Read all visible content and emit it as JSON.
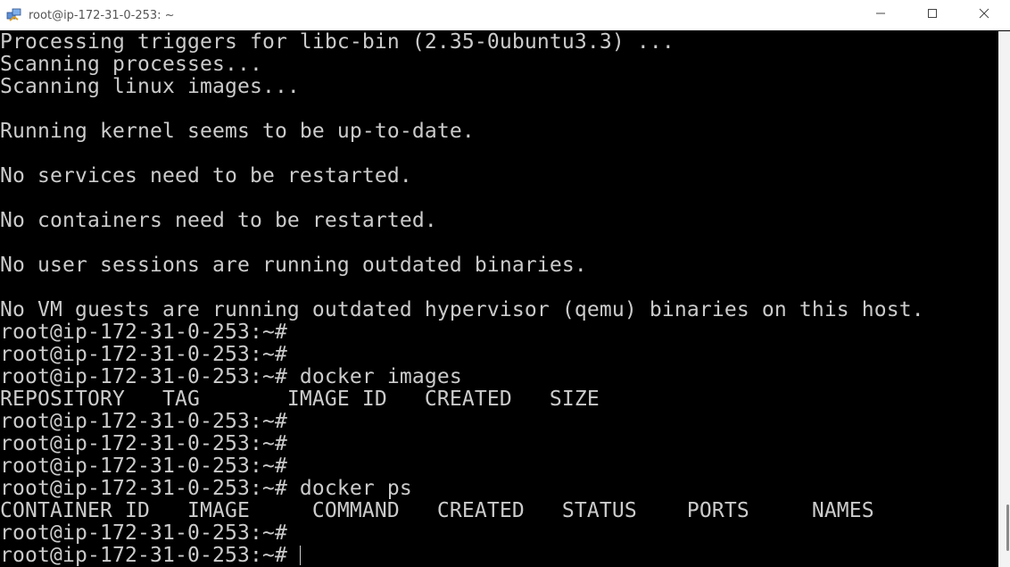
{
  "window": {
    "title": "root@ip-172-31-0-253: ~",
    "app_icon": "putty-icon",
    "controls": [
      "minimize-icon",
      "maximize-icon",
      "close-icon"
    ]
  },
  "terminal": {
    "lines": [
      "Processing triggers for libc-bin (2.35-0ubuntu3.3) ...",
      "Scanning processes...",
      "Scanning linux images...",
      "",
      "Running kernel seems to be up-to-date.",
      "",
      "No services need to be restarted.",
      "",
      "No containers need to be restarted.",
      "",
      "No user sessions are running outdated binaries.",
      "",
      "No VM guests are running outdated hypervisor (qemu) binaries on this host.",
      "root@ip-172-31-0-253:~#",
      "root@ip-172-31-0-253:~#",
      "root@ip-172-31-0-253:~# docker images",
      "REPOSITORY   TAG       IMAGE ID   CREATED   SIZE",
      "root@ip-172-31-0-253:~#",
      "root@ip-172-31-0-253:~#",
      "root@ip-172-31-0-253:~#",
      "root@ip-172-31-0-253:~# docker ps",
      "CONTAINER ID   IMAGE     COMMAND   CREATED   STATUS    PORTS     NAMES",
      "root@ip-172-31-0-253:~#",
      "root@ip-172-31-0-253:~#"
    ]
  },
  "colors": {
    "terminal_background": "#000000",
    "terminal_foreground": "#cbcbcb",
    "titlebar_background": "#ffffff"
  }
}
